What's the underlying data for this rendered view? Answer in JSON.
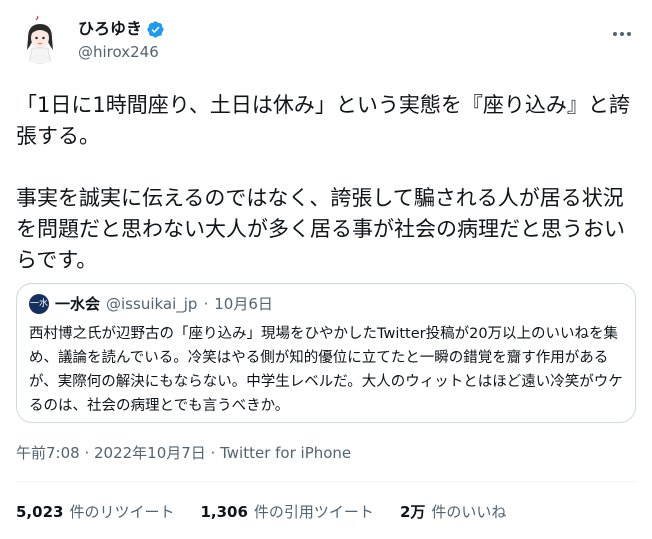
{
  "author": {
    "display_name": "ひろゆき",
    "handle": "@hirox246",
    "verified": true,
    "icons": {
      "avatar": "avatar-illustration",
      "verified": "verified-badge-icon",
      "more": "more-options-icon"
    }
  },
  "tweet": {
    "paragraph_1": "「1日に1時間座り、土日は休み」という実態を『座り込み』と誇張する。",
    "paragraph_2": "事実を誠実に伝えるのではなく、誇張して騙される人が居る状況を問題だと思わない大人が多く居る事が社会の病理だと思うおいらです。"
  },
  "quote_tweet": {
    "avatar_text": "一水",
    "name": "一水会",
    "handle": "@issuikai_jp",
    "separator": "·",
    "date": "10月6日",
    "text": "西村博之氏が辺野古の「座り込み」現場をひやかしたTwitter投稿が20万以上のいいねを集め、議論を読んでいる。冷笑はやる側が知的優位に立てたと一瞬の錯覚を齎す作用があるが、実際何の解決にもならない。中学生レベルだ。大人のウィットとはほど遠い冷笑がウケるのは、社会の病理とでも言うべきか。"
  },
  "meta": {
    "timestamp": "午前7:08 · 2022年10月7日 · Twitter for iPhone"
  },
  "stats": {
    "retweets_count": "5,023",
    "retweets_label": "件のリツイート",
    "quotes_count": "1,306",
    "quotes_label": "件の引用ツイート",
    "likes_count": "2万",
    "likes_label": "件のいいね"
  },
  "colors": {
    "text": "#0f1419",
    "secondary": "#536471",
    "verified": "#1d9bf0",
    "border": "#cfd9de"
  }
}
